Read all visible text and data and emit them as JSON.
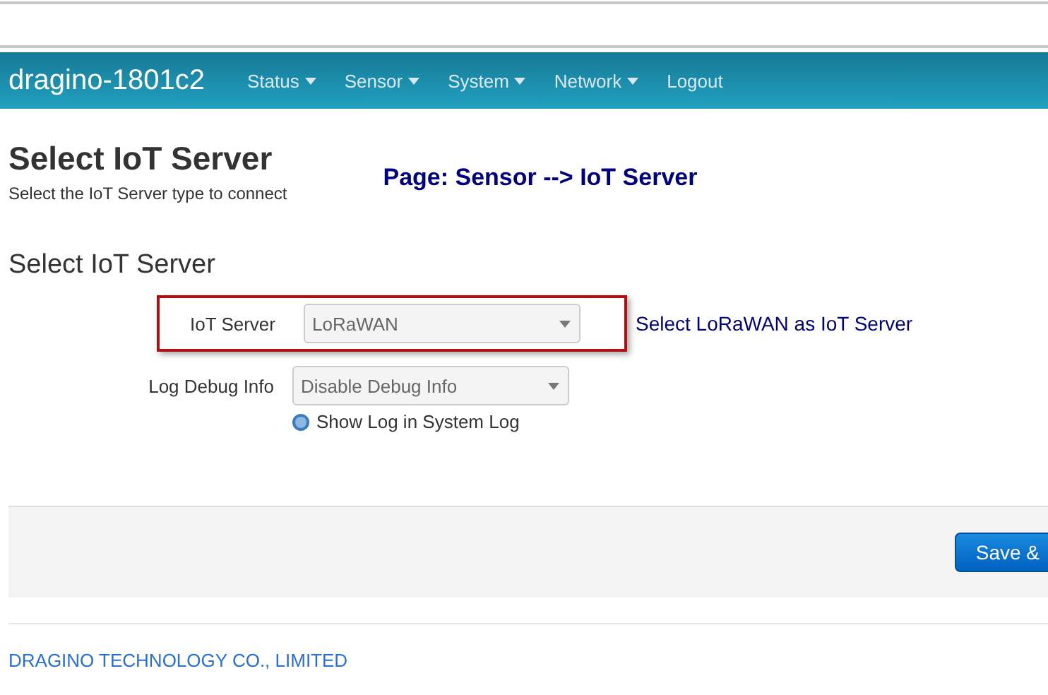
{
  "navbar": {
    "brand": "dragino-1801c2",
    "menus": [
      {
        "label": "Status",
        "dropdown": true
      },
      {
        "label": "Sensor",
        "dropdown": true
      },
      {
        "label": "System",
        "dropdown": true
      },
      {
        "label": "Network",
        "dropdown": true
      },
      {
        "label": "Logout",
        "dropdown": false
      }
    ]
  },
  "page": {
    "title": "Select IoT Server",
    "subtitle": "Select the IoT Server type to connect",
    "annotation": "Page: Sensor --> IoT Server"
  },
  "section": {
    "title": "Select IoT Server",
    "fields": [
      {
        "label": "IoT Server",
        "value": "LoRaWAN",
        "highlighted": true,
        "note": "Select  LoRaWAN as IoT Server"
      },
      {
        "label": "Log Debug Info",
        "value": "Disable Debug Info",
        "highlighted": false,
        "help": "Show Log in System Log"
      }
    ]
  },
  "actions": {
    "button": "Save &"
  },
  "footer": {
    "company": "DRAGINO TECHNOLOGY CO., LIMITED"
  }
}
